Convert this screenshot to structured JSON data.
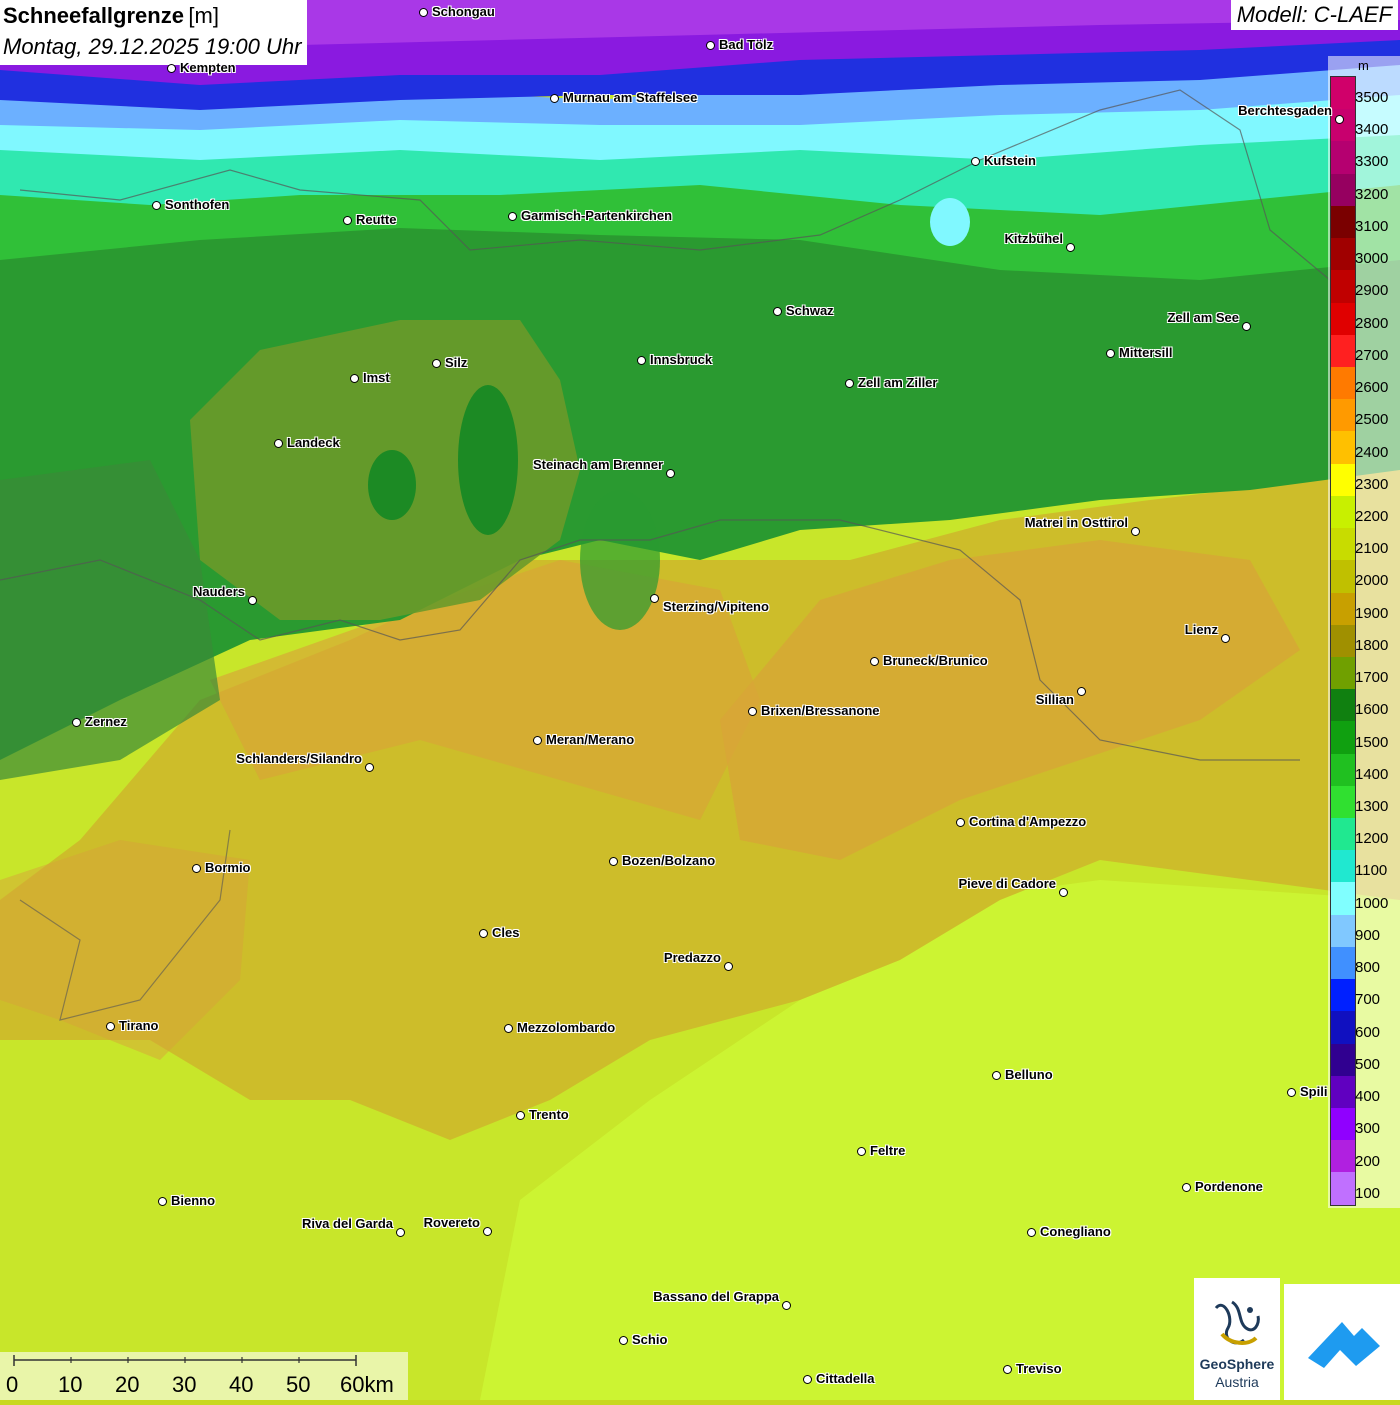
{
  "title": {
    "main": "Schneefallgrenze",
    "unit": "[m]",
    "datetime": "Montag, 29.12.2025 19:00 Uhr"
  },
  "model": "Modell: C-LAEF",
  "legend": {
    "unit": "m",
    "labels": [
      "3500",
      "3400",
      "3300",
      "3200",
      "3100",
      "3000",
      "2900",
      "2800",
      "2700",
      "2600",
      "2500",
      "2400",
      "2300",
      "2200",
      "2100",
      "2000",
      "1900",
      "1800",
      "1700",
      "1600",
      "1500",
      "1400",
      "1300",
      "1200",
      "1100",
      "1000",
      "900",
      "800",
      "700",
      "600",
      "500",
      "400",
      "300",
      "200",
      "100"
    ],
    "colors": [
      "#d0006a",
      "#c8006e",
      "#b50070",
      "#960060",
      "#7a0000",
      "#a00000",
      "#c00000",
      "#e00000",
      "#ff2020",
      "#ff7a00",
      "#ff9a00",
      "#ffc000",
      "#ffff00",
      "#c8f000",
      "#c8dc00",
      "#c0c000",
      "#c8a000",
      "#a09000",
      "#70a000",
      "#108010",
      "#10a010",
      "#20c020",
      "#30e030",
      "#20e890",
      "#20e8d0",
      "#80ffff",
      "#80c8ff",
      "#4090ff",
      "#0020ff",
      "#1010c0",
      "#300090",
      "#6000c0",
      "#9000ff",
      "#b020e0",
      "#c070ff"
    ]
  },
  "cities": [
    {
      "name": "Schongau"
    },
    {
      "name": "Bad Tölz"
    },
    {
      "name": "Kempten"
    },
    {
      "name": "Murnau am Staffelsee"
    },
    {
      "name": "Berchtesgaden"
    },
    {
      "name": "Kufstein"
    },
    {
      "name": "Sonthofen"
    },
    {
      "name": "Reutte"
    },
    {
      "name": "Garmisch-Partenkirchen"
    },
    {
      "name": "Kitzbühel"
    },
    {
      "name": "Schwaz"
    },
    {
      "name": "Zell am See"
    },
    {
      "name": "Silz"
    },
    {
      "name": "Innsbruck"
    },
    {
      "name": "Mittersill"
    },
    {
      "name": "Imst"
    },
    {
      "name": "Zell am Ziller"
    },
    {
      "name": "Landeck"
    },
    {
      "name": "Steinach am Brenner"
    },
    {
      "name": "Matrei in Osttirol"
    },
    {
      "name": "Nauders"
    },
    {
      "name": "Sterzing/Vipiteno"
    },
    {
      "name": "Lienz"
    },
    {
      "name": "Bruneck/Brunico"
    },
    {
      "name": "Sillian"
    },
    {
      "name": "Brixen/Bressanone"
    },
    {
      "name": "Zernez"
    },
    {
      "name": "Meran/Merano"
    },
    {
      "name": "Schlanders/Silandro"
    },
    {
      "name": "Cortina d'Ampezzo"
    },
    {
      "name": "Bozen/Bolzano"
    },
    {
      "name": "Bormio"
    },
    {
      "name": "Pieve di Cadore"
    },
    {
      "name": "Cles"
    },
    {
      "name": "Predazzo"
    },
    {
      "name": "Tirano"
    },
    {
      "name": "Mezzolombardo"
    },
    {
      "name": "Belluno"
    },
    {
      "name": "Spili"
    },
    {
      "name": "Trento"
    },
    {
      "name": "Feltre"
    },
    {
      "name": "Bienno"
    },
    {
      "name": "Pordenone"
    },
    {
      "name": "Riva del Garda"
    },
    {
      "name": "Rovereto"
    },
    {
      "name": "Conegliano"
    },
    {
      "name": "Bassano del Grappa"
    },
    {
      "name": "Schio"
    },
    {
      "name": "Treviso"
    },
    {
      "name": "Cittadella"
    }
  ],
  "scale": {
    "labels": [
      "0",
      "10",
      "20",
      "30",
      "40",
      "50",
      "60km"
    ]
  },
  "logo": {
    "line1": "GeoSphere",
    "line2": "Austria"
  }
}
